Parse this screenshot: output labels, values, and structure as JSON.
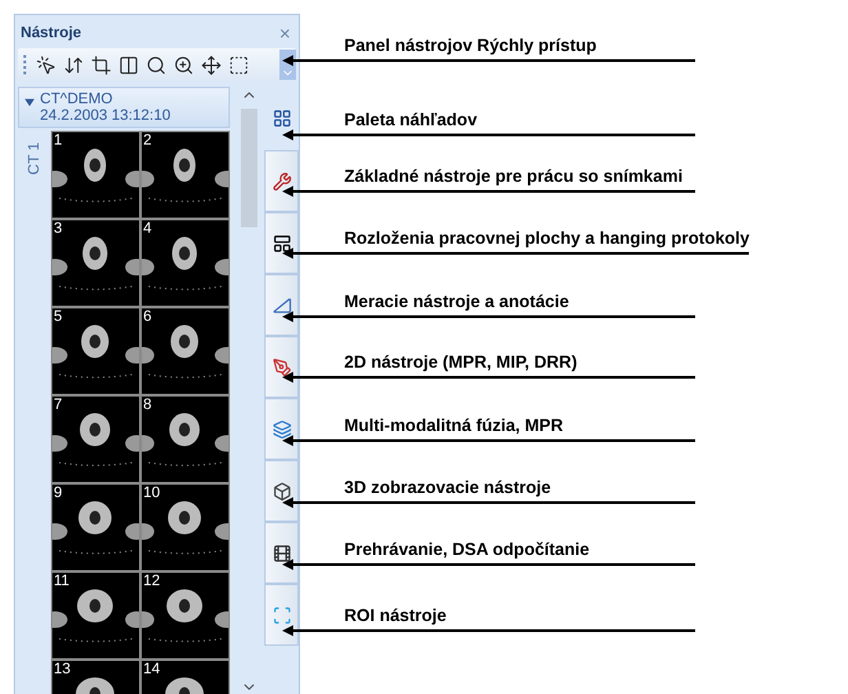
{
  "panel": {
    "title": "Nástroje",
    "close": "×"
  },
  "series": {
    "name": "CT^DEMO",
    "date": "24.2.2003 13:12:10",
    "expanded": true,
    "label": "CT 1"
  },
  "thumbnails": [
    "1",
    "2",
    "3",
    "4",
    "5",
    "6",
    "7",
    "8",
    "9",
    "10",
    "11",
    "12",
    "13",
    "14"
  ],
  "side_tabs": [
    {
      "selected": true
    },
    {
      "selected": false
    },
    {
      "selected": false
    },
    {
      "selected": false
    },
    {
      "selected": false
    },
    {
      "selected": false
    },
    {
      "selected": false
    },
    {
      "selected": false
    },
    {
      "selected": false
    }
  ],
  "callouts": [
    "Panel nástrojov Rýchly prístup",
    "Paleta náhľadov",
    "Základné nástroje pre prácu so snímkami",
    "Rozloženia pracovnej plochy a hanging protokoly",
    "Meracie nástroje a anotácie",
    "2D nástroje (MPR, MIP, DRR)",
    "Multi-modalitná fúzia, MPR",
    "3D zobrazovacie nástroje",
    "Prehrávanie, DSA odpočítanie",
    "ROI nástroje"
  ]
}
